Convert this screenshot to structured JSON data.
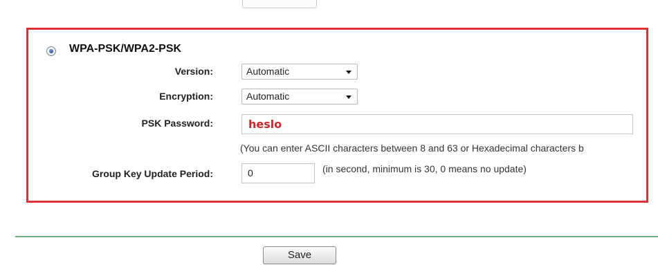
{
  "security": {
    "mode_label": "WPA-PSK/WPA2-PSK",
    "mode_selected": true,
    "version": {
      "label": "Version:",
      "value": "Automatic"
    },
    "encryption": {
      "label": "Encryption:",
      "value": "Automatic"
    },
    "psk_password": {
      "label": "PSK Password:",
      "value": "heslo",
      "hint": "(You can enter ASCII characters between 8 and 63 or Hexadecimal characters b"
    },
    "group_key": {
      "label": "Group Key Update Period:",
      "value": "0",
      "hint": "(in second, minimum is 30, 0 means no update)"
    }
  },
  "actions": {
    "save_label": "Save"
  },
  "colors": {
    "highlight": "#e03034",
    "password_text": "#d3232a",
    "separator": "#6fb07e"
  }
}
